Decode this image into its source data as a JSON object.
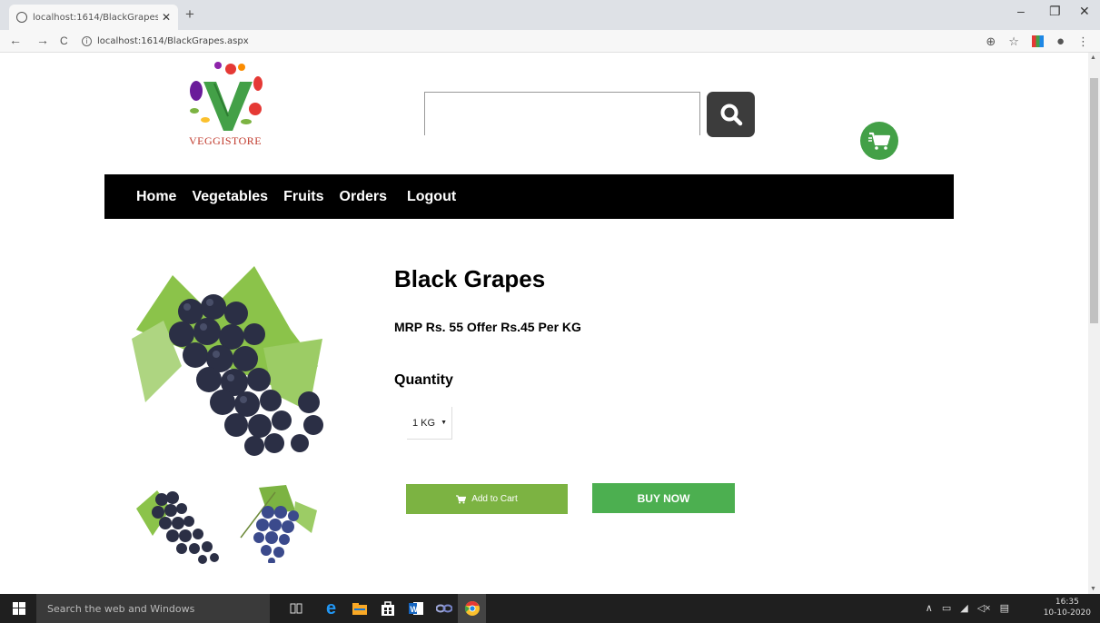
{
  "browser": {
    "tab_title": "localhost:1614/BlackGrapes.aspx",
    "tab_close": "✕",
    "new_tab": "+",
    "url": "localhost:1614/BlackGrapes.aspx",
    "window_controls": {
      "minimize": "–",
      "maximize": "❐",
      "close": "✕"
    },
    "nav": {
      "back": "←",
      "forward": "→",
      "reload": "C"
    }
  },
  "header": {
    "logo_text": "VEGGISTORE",
    "search_value": "",
    "search_icon": "search-icon",
    "cart_icon": "cart-icon"
  },
  "navbar": {
    "items": [
      "Home",
      "Vegetables",
      "Fruits",
      "Orders",
      "Logout"
    ]
  },
  "product": {
    "title": "Black Grapes",
    "price_text": "MRP Rs. 55 Offer Rs.45 Per KG",
    "quantity_label": "Quantity",
    "quantity_selected": "1 KG",
    "add_to_cart_label": "Add to Cart",
    "buy_now_label": "BUY NOW",
    "colors": {
      "add_to_cart": "#7cb342",
      "buy_now": "#4caf50",
      "navbar": "#000000"
    }
  },
  "taskbar": {
    "search_placeholder": "Search the web and Windows",
    "time": "16:35",
    "date": "10-10-2020"
  }
}
